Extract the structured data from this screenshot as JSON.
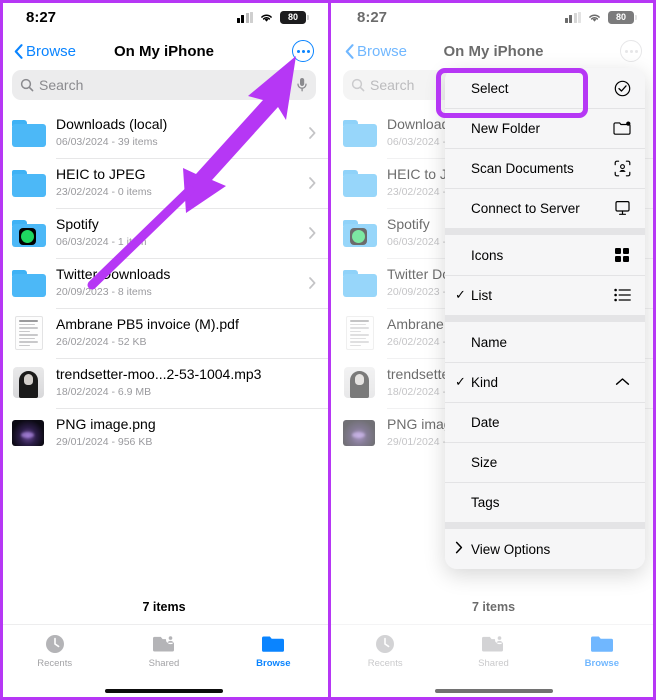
{
  "status_bar": {
    "time": "8:27",
    "battery_level": "80",
    "signal_icon": "cellular-signal-icon",
    "wifi_icon": "wifi-icon",
    "battery_icon": "battery-icon"
  },
  "nav": {
    "back_label": "Browse",
    "title": "On My iPhone",
    "more_icon": "more-ellipsis-icon"
  },
  "search": {
    "placeholder": "Search",
    "value": "",
    "search_icon": "search-icon",
    "mic_icon": "microphone-icon"
  },
  "files": [
    {
      "name": "Downloads (local)",
      "meta": "06/03/2024 - 39 items",
      "kind": "folder",
      "chevron": true
    },
    {
      "name": "HEIC to JPEG",
      "meta": "23/02/2024 - 0 items",
      "kind": "folder",
      "chevron": true
    },
    {
      "name": "Spotify",
      "meta": "06/03/2024 - 1 item",
      "kind": "folder-app",
      "chevron": true
    },
    {
      "name": "Twitter Downloads",
      "meta": "20/09/2023 - 8 items",
      "kind": "folder",
      "chevron": true
    },
    {
      "name": "Ambrane PB5 invoice (M).pdf",
      "meta": "26/02/2024 - 52 KB",
      "kind": "pdf",
      "chevron": false
    },
    {
      "name": "trendsetter-moo...2-53-1004.mp3",
      "meta": "18/02/2024 - 6.9 MB",
      "kind": "audio",
      "chevron": false
    },
    {
      "name": "PNG image.png",
      "meta": "29/01/2024 - 956 KB",
      "kind": "image",
      "chevron": false
    }
  ],
  "footer": {
    "item_count": "7 items",
    "tabs": [
      {
        "label": "Recents",
        "icon": "clock-icon",
        "active": false
      },
      {
        "label": "Shared",
        "icon": "shared-folder-icon",
        "active": false
      },
      {
        "label": "Browse",
        "icon": "folder-icon",
        "active": true
      }
    ]
  },
  "context_menu": {
    "groups": [
      {
        "items": [
          {
            "label": "Select",
            "icon": "check-circle-icon",
            "checked": false,
            "highlighted": true
          },
          {
            "label": "New Folder",
            "icon": "new-folder-icon",
            "checked": false,
            "highlighted": false
          },
          {
            "label": "Scan Documents",
            "icon": "scan-document-icon",
            "checked": false,
            "highlighted": false
          },
          {
            "label": "Connect to Server",
            "icon": "monitor-icon",
            "checked": false,
            "highlighted": false
          }
        ]
      },
      {
        "items": [
          {
            "label": "Icons",
            "icon": "grid-icon",
            "checked": false,
            "highlighted": false
          },
          {
            "label": "List",
            "icon": "list-icon",
            "checked": true,
            "highlighted": false
          }
        ]
      },
      {
        "items": [
          {
            "label": "Name",
            "icon": "",
            "checked": false,
            "highlighted": false
          },
          {
            "label": "Kind",
            "icon": "chevron-up-icon",
            "checked": true,
            "highlighted": false
          },
          {
            "label": "Date",
            "icon": "",
            "checked": false,
            "highlighted": false
          },
          {
            "label": "Size",
            "icon": "",
            "checked": false,
            "highlighted": false
          },
          {
            "label": "Tags",
            "icon": "",
            "checked": false,
            "highlighted": false
          }
        ]
      },
      {
        "items": [
          {
            "label": "View Options",
            "icon": "",
            "leading_icon": "chevron-right-icon",
            "checked": false,
            "highlighted": false
          }
        ]
      }
    ]
  },
  "annotation": {
    "arrow_color": "#b637f5",
    "highlight_color": "#b637f5",
    "frame_color": "#b637f5"
  },
  "colors": {
    "accent_blue": "#0a84ff",
    "folder_blue": "#4cb8f7",
    "separator": "#e7e7e8",
    "menu_bg": "#f6f6f7",
    "search_bg": "#ececed",
    "subtext": "#9a9a9e"
  }
}
